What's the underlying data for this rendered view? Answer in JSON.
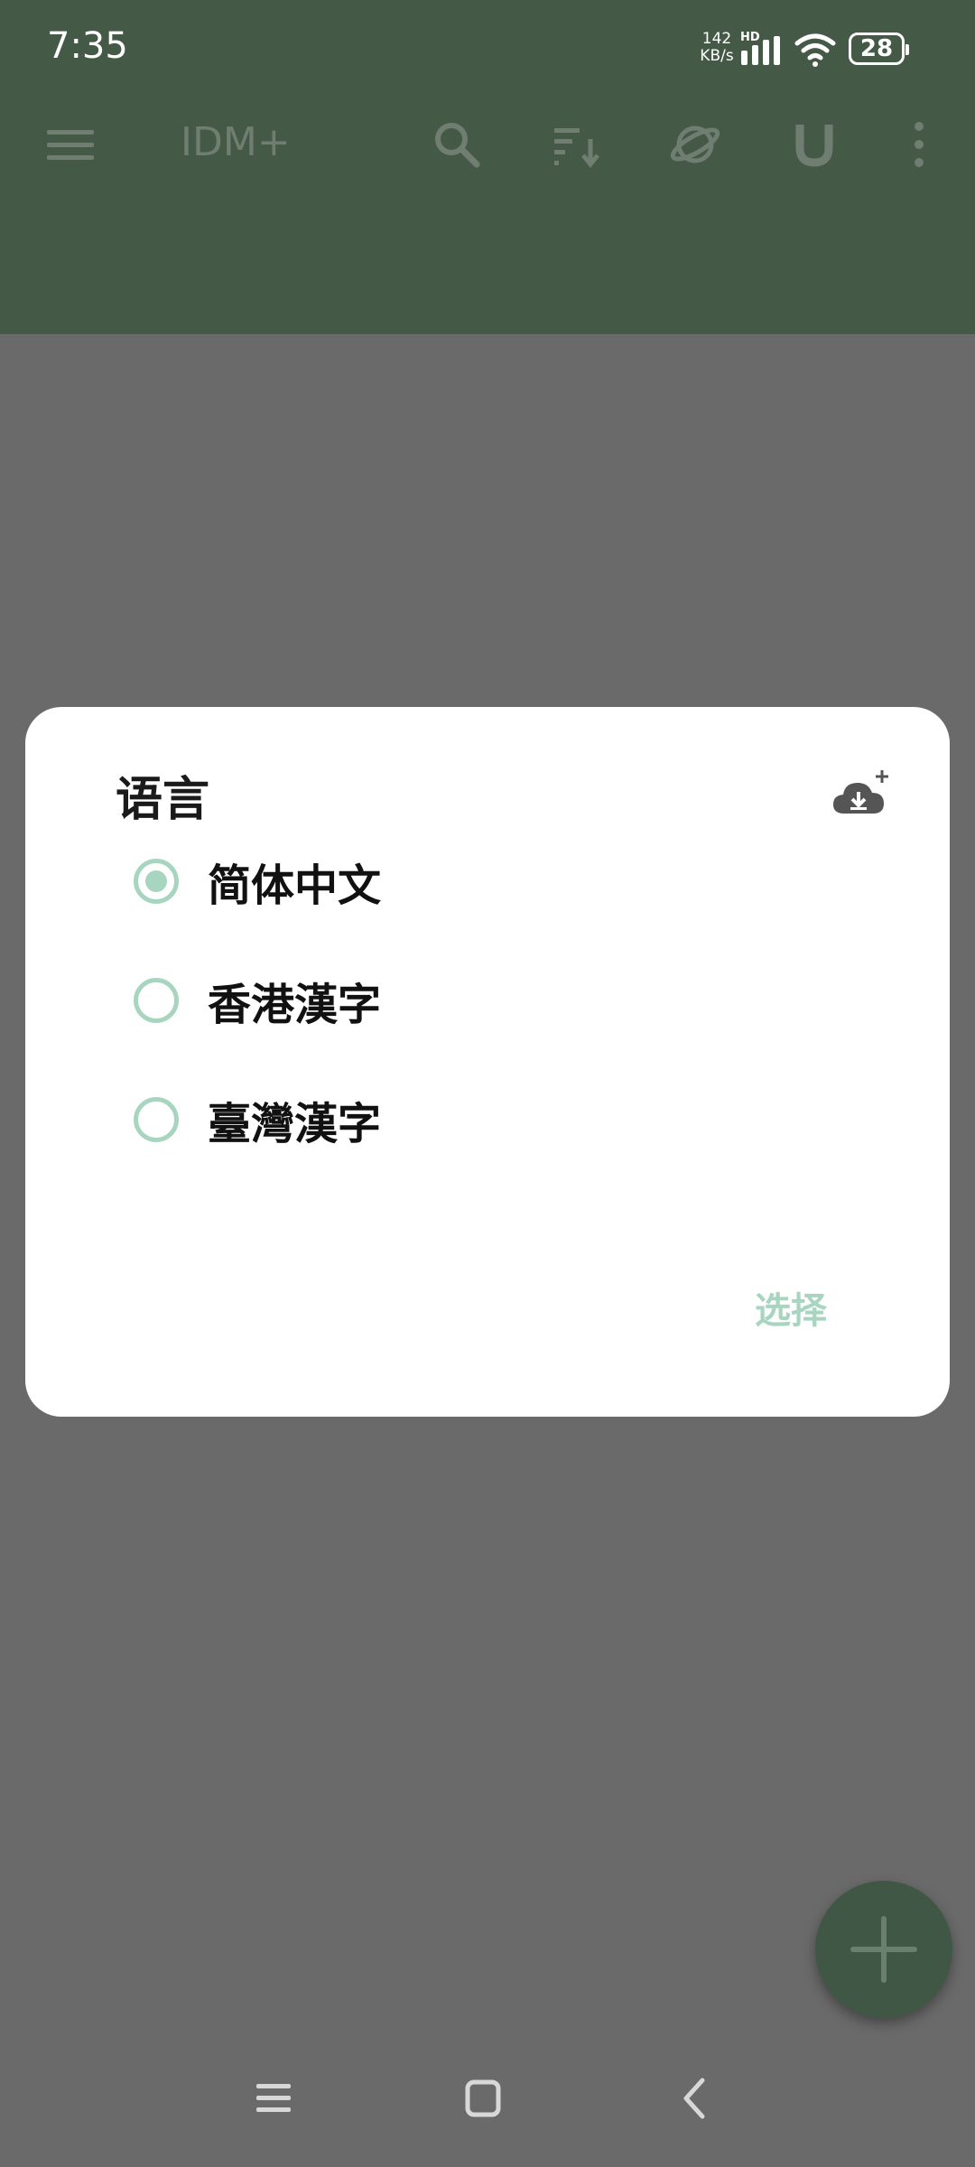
{
  "status_bar": {
    "time": "7:35",
    "net_speed_value": "142",
    "net_speed_unit": "KB/s",
    "hd_label": "HD",
    "battery_level": "28"
  },
  "toolbar": {
    "title": "IDM+",
    "icons": [
      "menu-icon",
      "search-icon",
      "sort-icon",
      "browser-planet-icon",
      "magnet-icon",
      "more-vert-icon"
    ]
  },
  "dialog": {
    "title": "语言",
    "action_icon": "cloud-download-add-icon",
    "options": [
      {
        "label": "简体中文",
        "selected": true
      },
      {
        "label": "香港漢字",
        "selected": false
      },
      {
        "label": "臺灣漢字",
        "selected": false
      }
    ],
    "confirm_label": "选择"
  },
  "fab": {
    "icon": "plus-icon"
  },
  "nav_bar": {
    "icons": [
      "recents-icon",
      "home-icon",
      "back-icon"
    ]
  },
  "colors": {
    "scrim": "#6a6a6a",
    "appbar_dimmed": "#455947",
    "accent_light": "#a8d5bf",
    "dialog_bg": "#ffffff"
  }
}
